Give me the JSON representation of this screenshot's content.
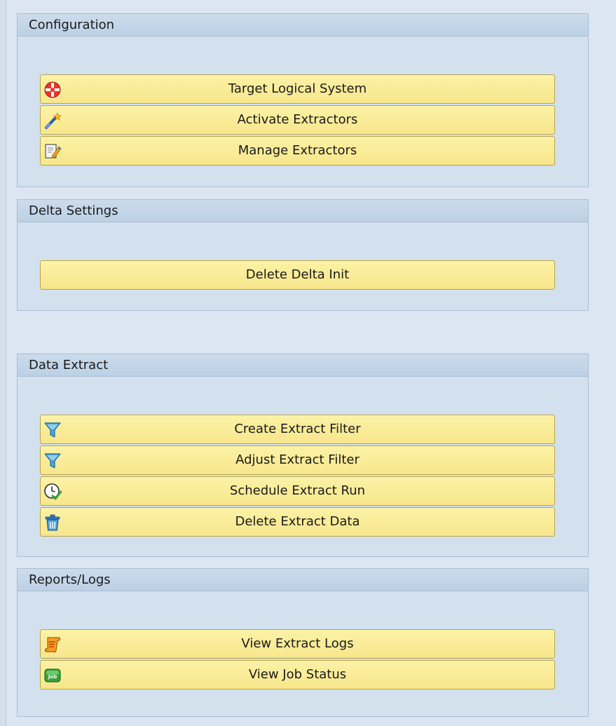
{
  "groups": [
    {
      "title": "Configuration",
      "buttons": [
        {
          "label": "Target Logical System",
          "icon": "target-icon"
        },
        {
          "label": "Activate Extractors",
          "icon": "magic-wand-icon"
        },
        {
          "label": "Manage Extractors",
          "icon": "edit-document-icon"
        }
      ]
    },
    {
      "title": "Delta Settings",
      "buttons": [
        {
          "label": "Delete Delta Init",
          "icon": ""
        }
      ]
    },
    {
      "title": "Data Extract",
      "buttons": [
        {
          "label": "Create Extract Filter",
          "icon": "filter-icon"
        },
        {
          "label": "Adjust Extract Filter",
          "icon": "filter-icon"
        },
        {
          "label": "Schedule Extract Run",
          "icon": "schedule-clock-icon"
        },
        {
          "label": "Delete Extract Data",
          "icon": "trash-icon"
        }
      ]
    },
    {
      "title": "Reports/Logs",
      "buttons": [
        {
          "label": "View Extract Logs",
          "icon": "scroll-log-icon"
        },
        {
          "label": "View Job Status",
          "icon": "job-icon"
        }
      ]
    }
  ],
  "colors": {
    "page_background": "#dbe6f2",
    "group_background": "#d3e1ef",
    "button_fill": "#f8e98f",
    "button_border": "#b7a54a"
  }
}
